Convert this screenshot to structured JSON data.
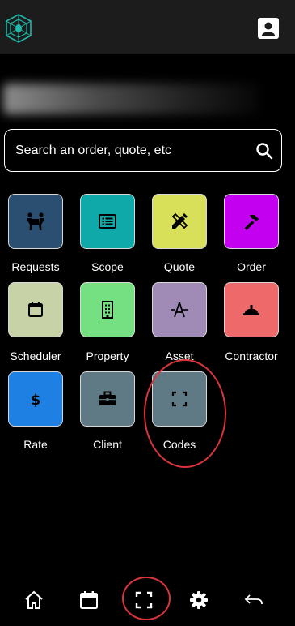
{
  "header": {
    "logo_icon": "spider-web-logo",
    "profile_icon": "contact-card-icon"
  },
  "search": {
    "placeholder": "Search an order, quote, etc",
    "icon": "search-icon"
  },
  "tiles": [
    {
      "label": "Requests",
      "icon": "people-carry-icon",
      "color": "#2a4f70"
    },
    {
      "label": "Scope",
      "icon": "list-icon",
      "color": "#0fa9a9"
    },
    {
      "label": "Quote",
      "icon": "pencil-ruler-icon",
      "color": "#d8e05a"
    },
    {
      "label": "Order",
      "icon": "hammer-icon",
      "color": "#c400f0"
    },
    {
      "label": "Scheduler",
      "icon": "calendar-icon",
      "color": "#c7d3a6"
    },
    {
      "label": "Property",
      "icon": "building-icon",
      "color": "#74e082"
    },
    {
      "label": "Asset",
      "icon": "asset-icon",
      "color": "#9f8bb6"
    },
    {
      "label": "Contractor",
      "icon": "hard-hat-icon",
      "color": "#ee6a6a"
    },
    {
      "label": "Rate",
      "icon": "dollar-icon",
      "color": "#1e80e2"
    },
    {
      "label": "Client",
      "icon": "briefcase-icon",
      "color": "#5f7a84"
    },
    {
      "label": "Codes",
      "icon": "scan-icon",
      "color": "#5f7a84"
    }
  ],
  "bottom_nav": [
    {
      "name": "home",
      "icon": "home-icon"
    },
    {
      "name": "calendar",
      "icon": "calendar-icon"
    },
    {
      "name": "scan",
      "icon": "scan-icon"
    },
    {
      "name": "settings",
      "icon": "gear-icon"
    },
    {
      "name": "back",
      "icon": "back-arrow-icon"
    }
  ],
  "colors": {
    "background": "#000000",
    "header": "#1c1c1c",
    "annotation": "#d9343b"
  }
}
